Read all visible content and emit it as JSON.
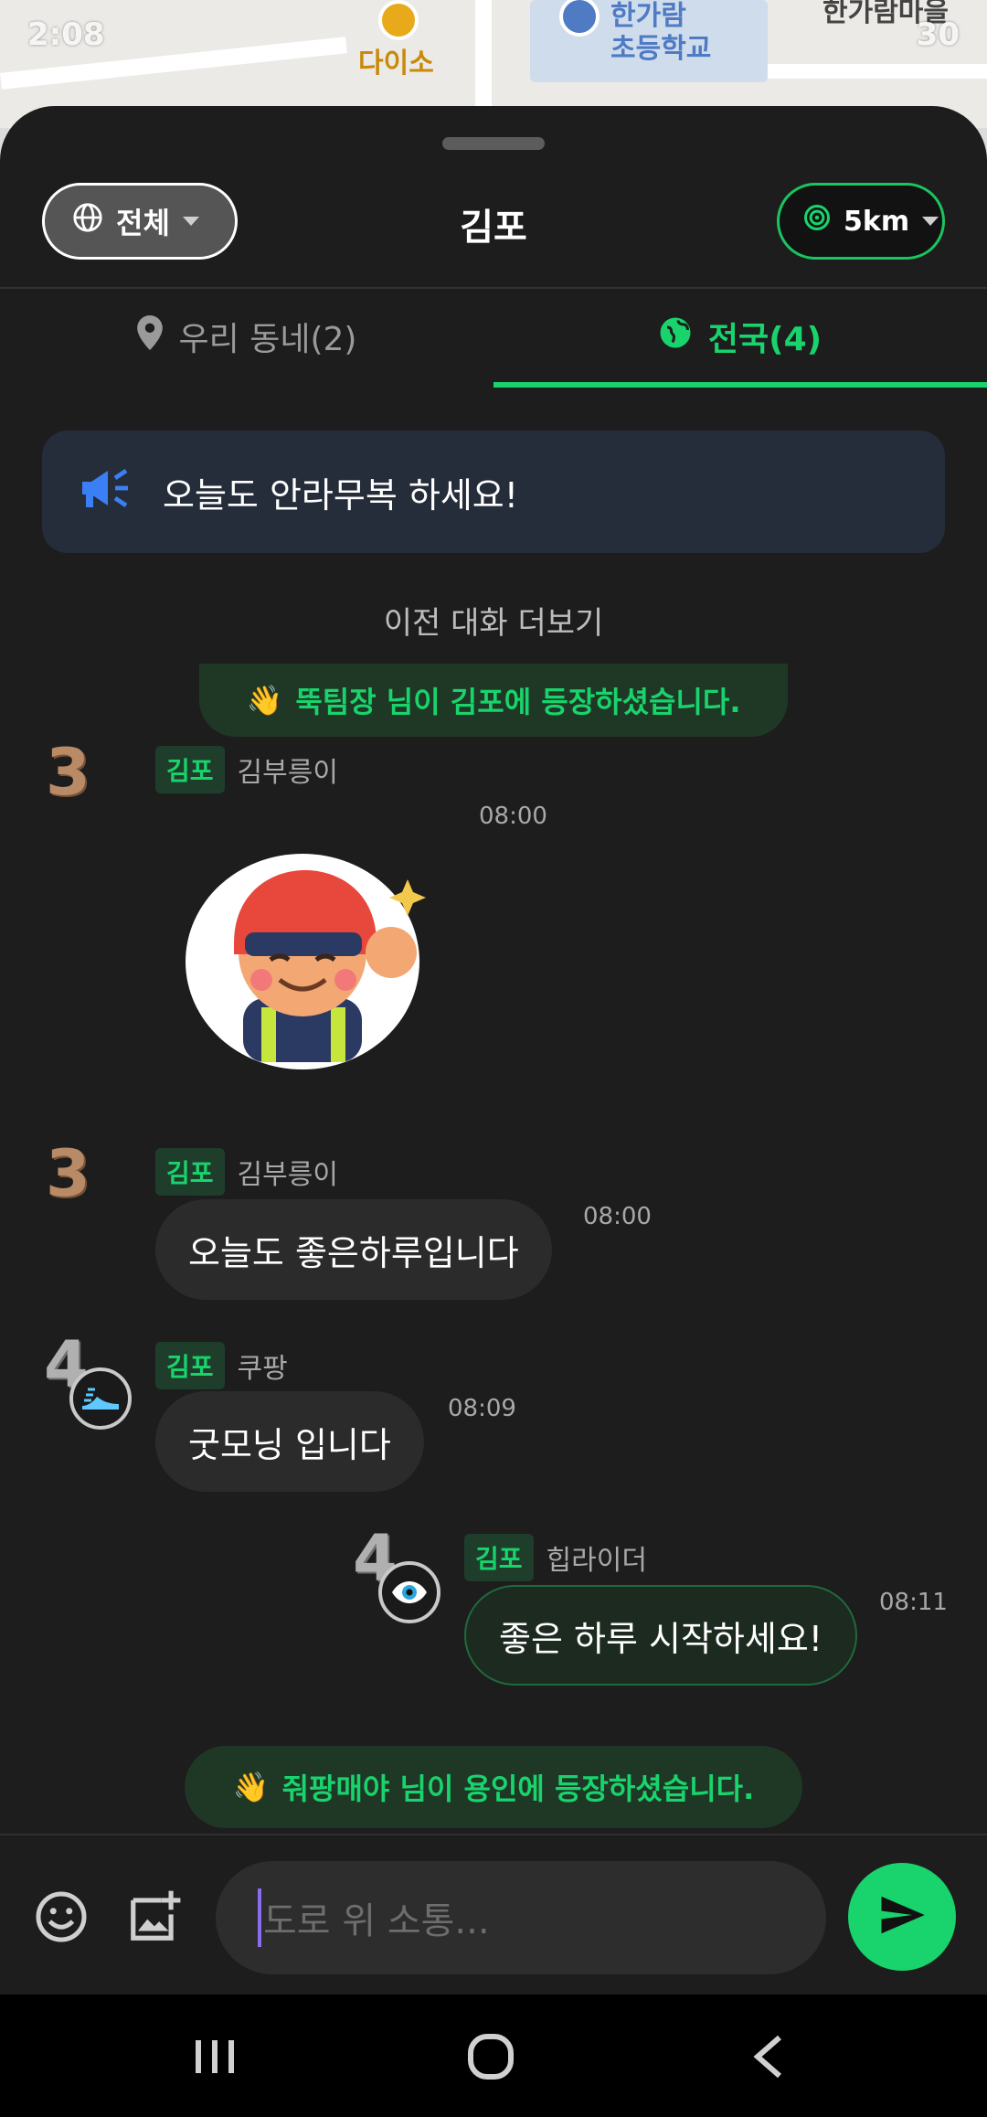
{
  "statusbar": {
    "time": "2:08",
    "battery": "30"
  },
  "map": {
    "poi_daiso": "다이소",
    "poi_school_line1": "한가람",
    "poi_school_line2": "초등학교",
    "poi_right": "한가람마을"
  },
  "header": {
    "scope_label": "전체",
    "title": "김포",
    "radius_label": "5km"
  },
  "tabs": {
    "local": "우리 동네(2)",
    "nation": "전국(4)"
  },
  "notice": {
    "text": "오늘도 안라무복 하세요!"
  },
  "feed": {
    "load_more": "이전 대화 더보기"
  },
  "system": {
    "join1": "뚝팀장 님이 김포에 등장하셨습니다.",
    "join2": "줘팡매야 님이 용인에 등장하셨습니다."
  },
  "messages": [
    {
      "level": "3",
      "region": "김포",
      "nick": "김부릉이",
      "time": "08:00",
      "type": "sticker"
    },
    {
      "level": "3",
      "region": "김포",
      "nick": "김부릉이",
      "time": "08:00",
      "text": "오늘도 좋은하루입니다"
    },
    {
      "level": "4",
      "region": "김포",
      "nick": "쿠팡",
      "time": "08:09",
      "text": "굿모닝 입니다"
    },
    {
      "level": "4",
      "region": "김포",
      "nick": "힙라이더",
      "time": "08:11",
      "text": "좋은 하루 시작하세요!"
    }
  ],
  "composer": {
    "placeholder": "도로 위 소통..."
  },
  "colors": {
    "accent": "#19d36c",
    "background": "#1d1d1d",
    "notice_bg": "#262d3a"
  }
}
